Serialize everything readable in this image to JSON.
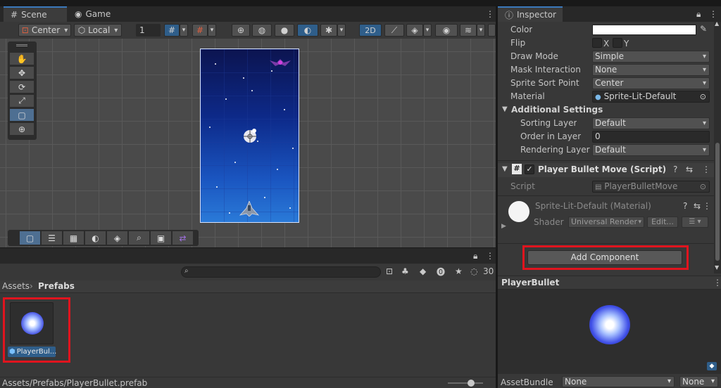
{
  "scene_tabs": {
    "scene": "Scene",
    "game": "Game"
  },
  "scene_toolbar": {
    "pivot": "Center",
    "space": "Local",
    "grid_size": "1",
    "mode_2d": "2D"
  },
  "project": {
    "breadcrumb_root": "Assets",
    "breadcrumb_current": "Prefabs",
    "asset_name": "PlayerBul...",
    "status_path": "Assets/Prefabs/PlayerBullet.prefab",
    "count": "30",
    "search_value": ""
  },
  "inspector": {
    "tab": "Inspector",
    "rows": {
      "color": "Color",
      "flip": "Flip",
      "flip_x": "X",
      "flip_y": "Y",
      "draw_mode": "Draw Mode",
      "draw_mode_value": "Simple",
      "mask_interaction": "Mask Interaction",
      "mask_interaction_value": "None",
      "sprite_sort_point": "Sprite Sort Point",
      "sprite_sort_point_value": "Center",
      "material": "Material",
      "material_value": "Sprite-Lit-Default",
      "additional_settings": "Additional Settings",
      "sorting_layer": "Sorting Layer",
      "sorting_layer_value": "Default",
      "order_in_layer": "Order in Layer",
      "order_in_layer_value": "0",
      "rendering_layer": "Rendering Layer M",
      "rendering_layer_value": "Default"
    },
    "script_component": {
      "title": "Player Bullet Move (Script)",
      "script_label": "Script",
      "script_value": "PlayerBulletMove"
    },
    "material_component": {
      "title": "Sprite-Lit-Default (Material)",
      "shader_label": "Shader",
      "shader_value": "Universal Render",
      "edit_label": "Edit..."
    },
    "add_component": "Add Component",
    "preview_title": "PlayerBullet",
    "asset_bundle_label": "AssetBundle",
    "asset_bundle_value": "None",
    "asset_bundle_variant": "None"
  },
  "colors": {
    "accent": "#3a79bb",
    "highlight_red": "#e0141e",
    "panel": "#383838",
    "scene_bg": "#4a4a4a"
  }
}
